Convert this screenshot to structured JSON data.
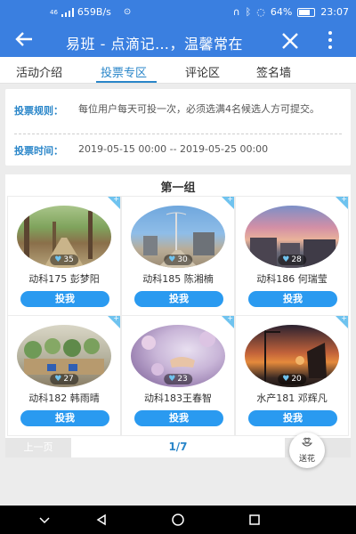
{
  "status_bar": {
    "network": "46",
    "speed": "659B/s",
    "battery": "64%",
    "time": "23:07"
  },
  "header": {
    "title": "易班 - 点滴记…，温馨常在"
  },
  "tabs": [
    {
      "label": "活动介绍"
    },
    {
      "label": "投票专区"
    },
    {
      "label": "评论区"
    },
    {
      "label": "签名墙"
    }
  ],
  "rules": {
    "rule_label": "投票规则：",
    "rule_text": "每位用户每天可投一次，必须选满4名候选人方可提交。",
    "time_label": "投票时间：",
    "time_text": "2019-05-15 00:00 -- 2019-05-25 00:00"
  },
  "group": {
    "title": "第一组",
    "candidates": [
      {
        "name": "动科175 彭梦阳",
        "votes": "35",
        "vote_label": "投我"
      },
      {
        "name": "动科185 陈湘楠",
        "votes": "30",
        "vote_label": "投我"
      },
      {
        "name": "动科186 何瑞莹",
        "votes": "28",
        "vote_label": "投我"
      },
      {
        "name": "动科182 韩雨晴",
        "votes": "27",
        "vote_label": "投我"
      },
      {
        "name": "动科183王春智",
        "votes": "23",
        "vote_label": "投我"
      },
      {
        "name": "水产181 邓辉凡",
        "votes": "20",
        "vote_label": "投我"
      }
    ]
  },
  "pager": {
    "prev_label": "上一页",
    "page": "1/7",
    "next_label": "页"
  },
  "flower": {
    "label": "送花"
  },
  "colors": {
    "header": "#3a7fe0",
    "accent": "#2a86c9",
    "vote_button": "#2a9af0"
  }
}
